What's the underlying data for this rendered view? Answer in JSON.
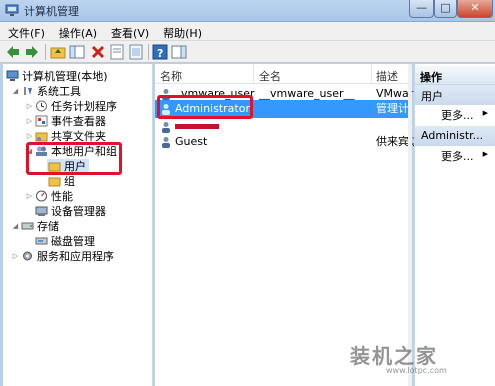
{
  "window": {
    "title": "计算机管理",
    "min": "—",
    "max": "□",
    "close": "✕"
  },
  "menu": [
    "文件(F)",
    "操作(A)",
    "查看(V)",
    "帮助(H)"
  ],
  "tree": {
    "root": "计算机管理(本地)",
    "system_tools": "系统工具",
    "task_scheduler": "任务计划程序",
    "event_viewer": "事件查看器",
    "shared_folders": "共享文件夹",
    "local_users_groups": "本地用户和组",
    "users": "用户",
    "groups": "组",
    "performance": "性能",
    "device_manager": "设备管理器",
    "storage": "存储",
    "disk_management": "磁盘管理",
    "services_apps": "服务和应用程序"
  },
  "list": {
    "columns": [
      "名称",
      "全名",
      "描述"
    ],
    "rows": [
      {
        "name": "vmware_user",
        "full_name": "__vmware_user__",
        "desc": "VMwar"
      },
      {
        "name": "Administrator",
        "full_name": "",
        "desc": "管理计"
      },
      {
        "name": "",
        "full_name": "",
        "desc": ""
      },
      {
        "name": "Guest",
        "full_name": "",
        "desc": "供来宾访"
      }
    ]
  },
  "actions": {
    "header": "操作",
    "section1": "用户",
    "more1": "更多...",
    "section2": "Administr...",
    "more2": "更多..."
  },
  "watermark": {
    "text": "装机之家",
    "url": "www.lotpc.com"
  },
  "colors": {
    "highlight": "#3399ff",
    "annotation": "#e3102c",
    "accent_frame": "#b9d1ea"
  }
}
